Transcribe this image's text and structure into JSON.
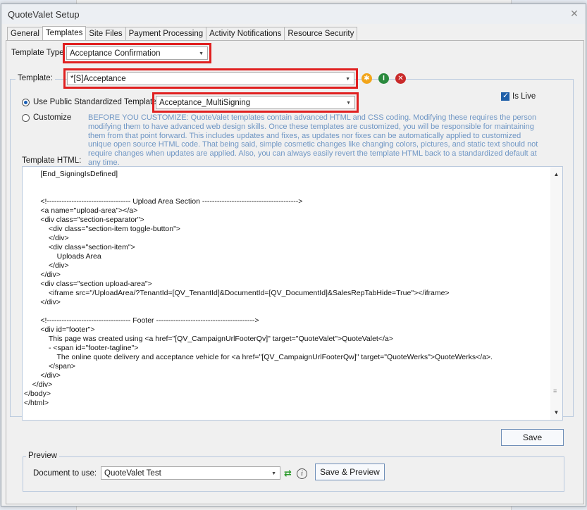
{
  "window": {
    "title": "QuoteValet Setup",
    "close_glyph": "✕"
  },
  "tabs": [
    {
      "label": "General"
    },
    {
      "label": "Templates",
      "active": true
    },
    {
      "label": "Site Files"
    },
    {
      "label": "Payment Processing"
    },
    {
      "label": "Activity Notifications"
    },
    {
      "label": "Resource Security"
    }
  ],
  "template_type": {
    "label": "Template Type",
    "value": "Acceptance Confirmation"
  },
  "template": {
    "group_label": "Template:",
    "value": "*[S]Acceptance",
    "action_icons": [
      {
        "name": "options-icon",
        "glyph": "✱",
        "color": "#f2a51a"
      },
      {
        "name": "info-icon",
        "glyph": "I",
        "color": "#2b8a3e"
      },
      {
        "name": "delete-icon",
        "glyph": "✕",
        "color": "#c92a2a"
      }
    ]
  },
  "use_public": {
    "label": "Use Public Standardized Template:",
    "value": "Acceptance_MultiSigning",
    "selected": true
  },
  "is_live": {
    "label": "Is Live",
    "checked": true
  },
  "customize": {
    "label": "Customize",
    "warning": "BEFORE YOU CUSTOMIZE: QuoteValet templates contain advanced HTML and CSS coding. Modifying these requires the person modifying them to have advanced web design skills. Once these templates are customized, you will be responsible for maintaining them from that point forward. This includes updates and fixes, as updates nor fixes can be automatically applied to customized unique open source HTML code. That being said, simple cosmetic changes like changing colors, pictures, and static text should not require changes when updates are applied.  Also, you can always easily revert the template HTML back to a standardized default at any time."
  },
  "template_html": {
    "label": "Template HTML:",
    "lines": [
      "        [End_SigningIsDefined]",
      "",
      "",
      "        <!---------------------------------- Upload Area Section --------------------------------------->",
      "        <a name=\"upload-area\"></a>",
      "        <div class=\"section-separator\">",
      "            <div class=\"section-item toggle-button\">",
      "            </div>",
      "            <div class=\"section-item\">",
      "                Uploads Area",
      "            </div>",
      "        </div>",
      "        <div class=\"section upload-area\">",
      "            <iframe src=\"/UploadArea/?TenantId=[QV_TenantId]&DocumentId=[QV_DocumentId]&SalesRepTabHide=True\"></iframe>",
      "        </div>",
      "",
      "        <!---------------------------------- Footer ---------------------------------------->",
      "        <div id=\"footer\">",
      "            This page was created using <a href=\"[QV_CampaignUrlFooterQv]\" target=\"QuoteValet\">QuoteValet</a>",
      "            - <span id=\"footer-tagline\">",
      "                The online quote delivery and acceptance vehicle for <a href=\"[QV_CampaignUrlFooterQw]\" target=\"QuoteWerks\">QuoteWerks</a>.",
      "            </span>",
      "        </div>",
      "    </div>",
      "</body>",
      "</html>"
    ]
  },
  "save_button": {
    "label": "Save"
  },
  "preview": {
    "group_label": "Preview",
    "doc_label": "Document to use:",
    "doc_value": "QuoteValet Test",
    "button_label": "Save & Preview",
    "refresh_glyph": "⇄",
    "info_glyph": "i"
  }
}
